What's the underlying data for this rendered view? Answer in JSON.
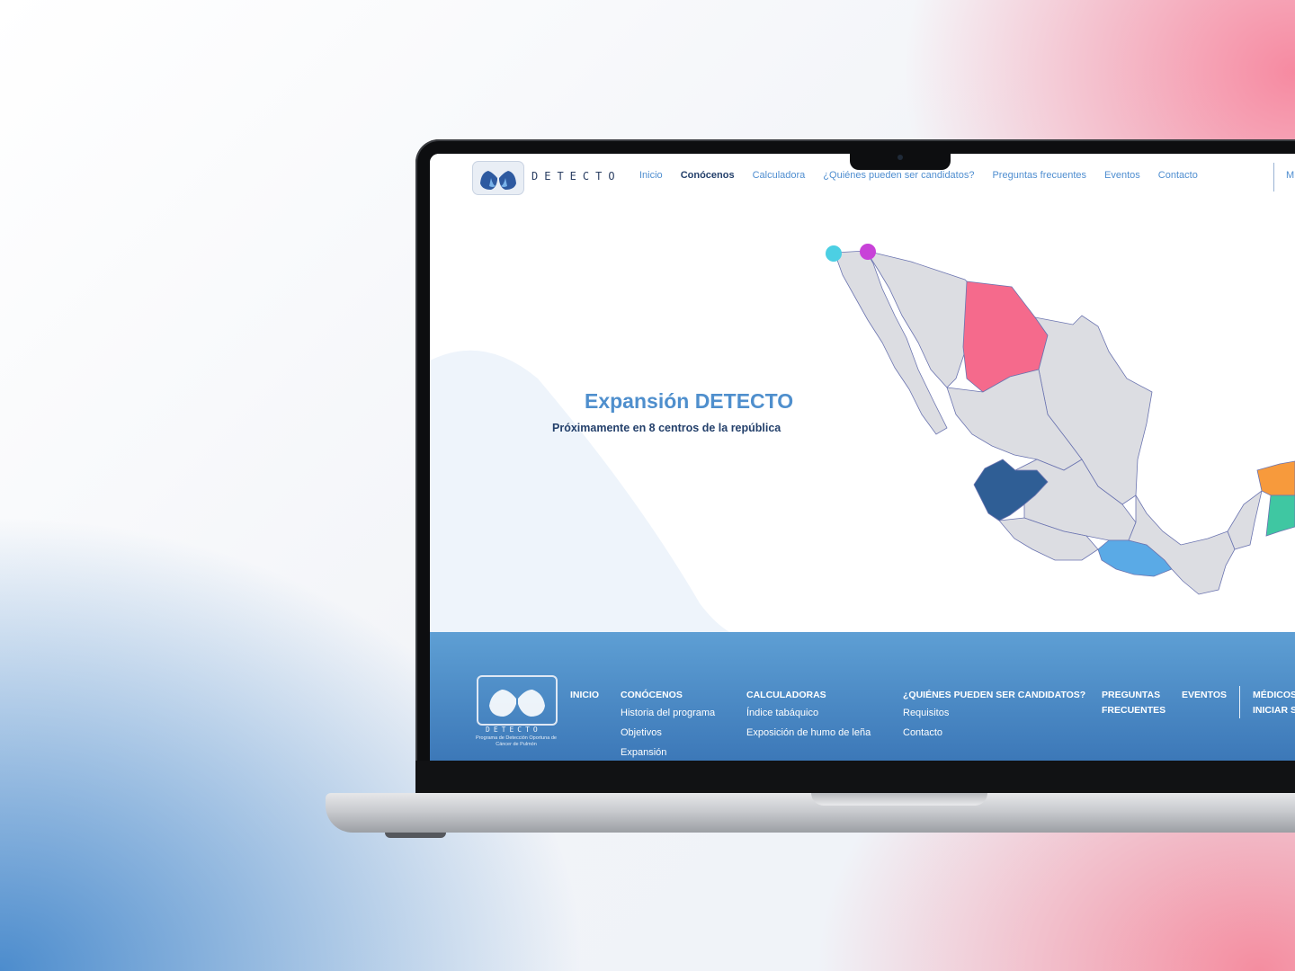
{
  "nav": {
    "items": [
      "Inicio",
      "Conócenos",
      "Calculadora",
      "¿Quiénes pueden ser candidatos?",
      "Preguntas frecuentes",
      "Eventos",
      "Contacto"
    ],
    "active": "Conócenos",
    "cut_item": "M",
    "logo_text": "DETECTO"
  },
  "hero": {
    "title": "Expansión DETECTO",
    "subtitle": "Próximamente en 8 centros de la república"
  },
  "map": {
    "highlight_colors": {
      "chihuahua": "#f56a8c",
      "jalisco": "#2f5e95",
      "oaxaca": "#5aaae6",
      "yucatan": "#f79a3c",
      "quintana_roo": "#3fc7a2",
      "marker_cyan": "#4ccfe3",
      "marker_magenta": "#c842d8",
      "base_state": "#dcdde2"
    }
  },
  "footer": {
    "logo_text": "DETECTO",
    "logo_subtitle": "Programa de Detección Oportuna de Cáncer de Pulmón",
    "cols": [
      {
        "heading": "INICIO",
        "items": []
      },
      {
        "heading": "CONÓCENOS",
        "items": [
          "Historia del programa",
          "Objetivos",
          "Expansión"
        ]
      },
      {
        "heading": "CALCULADORAS",
        "items": [
          "Índice tabáquico",
          "Exposición de humo de leña"
        ]
      },
      {
        "heading": "¿QUIÉNES PUEDEN SER CANDIDATOS?",
        "items": [
          "Requisitos",
          "Contacto"
        ]
      },
      {
        "heading": "PREGUNTAS FRECUENTES",
        "items": []
      },
      {
        "heading": "EVENTOS",
        "items": []
      },
      {
        "heading": "MÉDICOS INICIAR S",
        "items": []
      }
    ],
    "cut_col_lines": [
      "MÉDICOS",
      "INICIAR S"
    ],
    "faq_lines": [
      "PREGUNTAS",
      "FRECUENTES"
    ]
  }
}
